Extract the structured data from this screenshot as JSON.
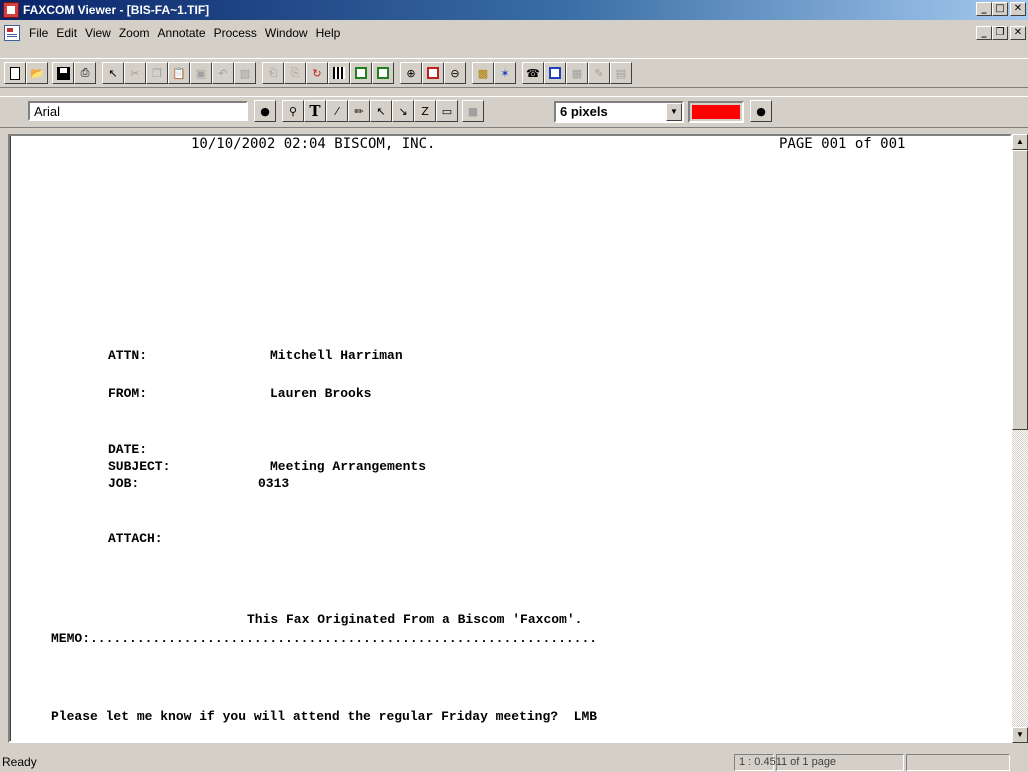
{
  "window": {
    "title": "FAXCOM Viewer - [BIS-FA~1.TIF]",
    "controls": {
      "minimize": "_",
      "maximize": "□",
      "close": "✕"
    },
    "mdi_controls": {
      "minimize": "_",
      "restore": "❐",
      "close": "✕"
    }
  },
  "menu": {
    "items": [
      "File",
      "Edit",
      "View",
      "Zoom",
      "Annotate",
      "Process",
      "Window",
      "Help"
    ]
  },
  "annotate_toolbar": {
    "font_name": "Arial",
    "line_width": "6 pixels",
    "color": "#ff0000"
  },
  "document": {
    "header_left": "10/10/2002 02:04 BISCOM, INC.",
    "header_right": "PAGE 001 of 001",
    "attn_label": "ATTN:",
    "attn_value": "Mitchell Harriman",
    "from_label": "FROM:",
    "from_value": "Lauren Brooks",
    "date_label": "DATE:",
    "subject_label": "SUBJECT:",
    "subject_value": "Meeting Arrangements",
    "job_label": "JOB:",
    "job_value": "0313",
    "attach_label": "ATTACH:",
    "origin": "This Fax Originated From a Biscom 'Faxcom'.",
    "memo": "MEMO:.................................................................",
    "message": "Please let me know if you will attend the regular Friday meeting?  LMB"
  },
  "status": {
    "text": "Ready",
    "zoom": "1 : 0.451",
    "page_count": "1 of 1 page"
  }
}
